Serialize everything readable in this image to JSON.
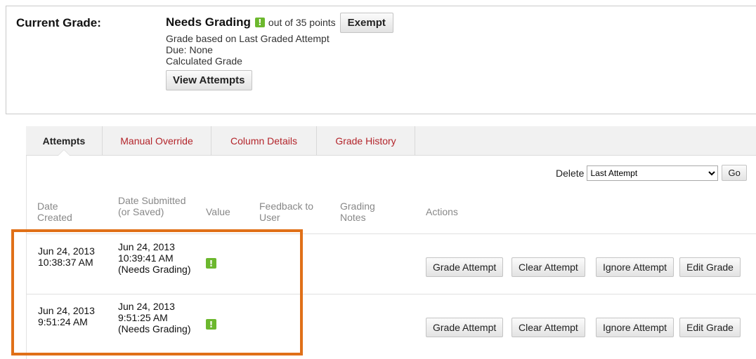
{
  "current_grade": {
    "label": "Current Grade:",
    "status": "Needs Grading",
    "out_of": "out of 35 points",
    "exempt_label": "Exempt",
    "basis": "Grade based on Last Graded Attempt",
    "due": "Due: None",
    "calculated": "Calculated Grade",
    "view_attempts_label": "View Attempts",
    "status_icon": "needs-grading-icon",
    "status_icon_glyph": "!"
  },
  "tabs": [
    {
      "label": "Attempts",
      "active": true
    },
    {
      "label": "Manual Override",
      "active": false
    },
    {
      "label": "Column Details",
      "active": false
    },
    {
      "label": "Grade History",
      "active": false
    }
  ],
  "delete_bar": {
    "label": "Delete",
    "selected": "Last Attempt",
    "go_label": "Go"
  },
  "table": {
    "headers": {
      "date_created": "Date Created",
      "date_submitted": "Date Submitted (or Saved)",
      "value": "Value",
      "feedback": "Feedback to User",
      "grading_notes": "Grading Notes",
      "actions": "Actions"
    },
    "rows": [
      {
        "created": "Jun 24, 2013 10:38:37 AM",
        "submitted": "Jun 24, 2013 10:39:41 AM (Needs Grading)",
        "value_icon": "needs-grading-icon",
        "actions": [
          "Grade Attempt",
          "Clear Attempt",
          "Ignore Attempt",
          "Edit Grade"
        ]
      },
      {
        "created": "Jun 24, 2013 9:51:24 AM",
        "submitted": "Jun 24, 2013 9:51:25 AM (Needs Grading)",
        "value_icon": "needs-grading-icon",
        "actions": [
          "Grade Attempt",
          "Clear Attempt",
          "Ignore Attempt",
          "Edit Grade"
        ]
      }
    ]
  },
  "colors": {
    "accent_tab_text": "#b3242a",
    "needs_grading_icon": "#6cb82e",
    "highlight_border": "#e07018"
  }
}
